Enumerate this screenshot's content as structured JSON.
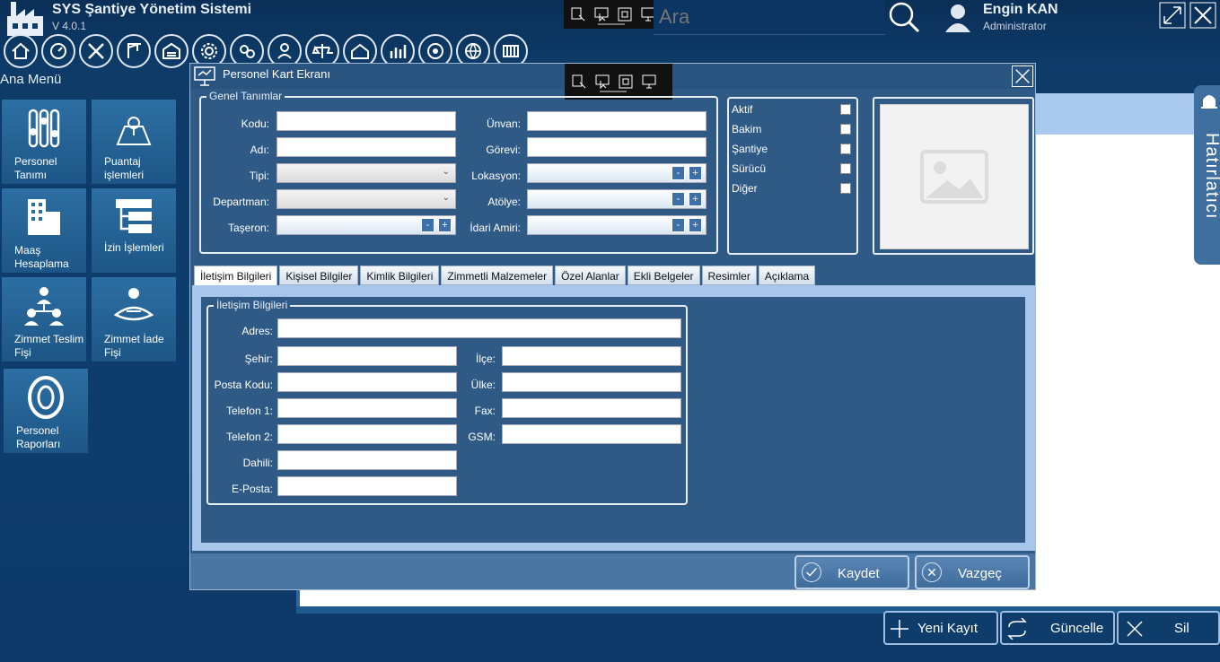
{
  "app": {
    "title": "SYS Şantiye Yönetim Sistemi",
    "version": "V 4.0.1"
  },
  "search": {
    "placeholder": "Ara"
  },
  "user": {
    "name": "Engin KAN",
    "role": "Administrator"
  },
  "menu": {
    "title": "Ana Menü",
    "tiles": [
      {
        "label": "Personel Tanımı",
        "icon": "sliders-icon"
      },
      {
        "label": "Puantaj işlemleri",
        "icon": "map-pin-icon"
      },
      {
        "label": "Maaş Hesaplama",
        "icon": "building-icon"
      },
      {
        "label": "İzin İşlemleri",
        "icon": "hierarchy-icon"
      },
      {
        "label": "Zimmet Teslim Fişi",
        "icon": "people-network-icon"
      },
      {
        "label": "Zimmet İade Fişi",
        "icon": "hand-return-icon"
      },
      {
        "label": "Personel Raporları",
        "icon": "tire-icon"
      }
    ]
  },
  "toolbar_icons": [
    "home-icon",
    "dashboard-icon",
    "tools-icon",
    "crane-icon",
    "warehouse-icon",
    "gear-settings-icon",
    "settings-group-icon",
    "worker-icon",
    "scale-icon",
    "house-icon",
    "chart-building-icon",
    "globe-network-icon",
    "globe-icon",
    "barrier-icon"
  ],
  "modal": {
    "title": "Personel Kart Ekranı",
    "general": {
      "title": "Genel Tanımlar",
      "fields_left": [
        {
          "label": "Kodu:",
          "type": "text",
          "value": ""
        },
        {
          "label": "Adı:",
          "type": "text",
          "value": ""
        },
        {
          "label": "Tipi:",
          "type": "combo",
          "value": ""
        },
        {
          "label": "Departman:",
          "type": "combo",
          "value": ""
        },
        {
          "label": "Taşeron:",
          "type": "spin",
          "value": ""
        }
      ],
      "fields_right": [
        {
          "label": "Ünvan:",
          "type": "text",
          "value": ""
        },
        {
          "label": "Görevi:",
          "type": "text",
          "value": ""
        },
        {
          "label": "Lokasyon:",
          "type": "spin",
          "value": ""
        },
        {
          "label": "Atölye:",
          "type": "spin",
          "value": ""
        },
        {
          "label": "İdari Amiri:",
          "type": "spin",
          "value": ""
        }
      ]
    },
    "flags": [
      {
        "label": "Aktif",
        "checked": false
      },
      {
        "label": "Bakim",
        "checked": false
      },
      {
        "label": "Şantiye",
        "checked": false
      },
      {
        "label": "Sürücü",
        "checked": false
      },
      {
        "label": "Diğer",
        "checked": false
      }
    ],
    "tabs": [
      "İletişim Bilgileri",
      "Kişisel Bilgiler",
      "Kimlik Bilgileri",
      "Zimmetli Malzemeler",
      "Özel Alanlar",
      "Ekli Belgeler",
      "Resimler",
      "Açıklama"
    ],
    "active_tab": "İletişim Bilgileri",
    "contact": {
      "title": "İletişim Bilgileri",
      "address_label": "Adres:",
      "left": [
        {
          "label": "Şehir:",
          "value": ""
        },
        {
          "label": "Posta Kodu:",
          "value": ""
        },
        {
          "label": "Telefon 1:",
          "value": ""
        },
        {
          "label": "Telefon 2:",
          "value": ""
        },
        {
          "label": "Dahili:",
          "value": ""
        },
        {
          "label": "E-Posta:",
          "value": ""
        }
      ],
      "right": [
        {
          "label": "İlçe:",
          "value": ""
        },
        {
          "label": "Ülke:",
          "value": ""
        },
        {
          "label": "Fax:",
          "value": ""
        },
        {
          "label": "GSM:",
          "value": ""
        }
      ]
    },
    "buttons": {
      "save": "Kaydet",
      "cancel": "Vazgeç"
    }
  },
  "background_actions": {
    "new": "Yeni Kayıt",
    "update": "Güncelle",
    "delete": "Sil"
  },
  "notifications": {
    "label": "Hatırlatıcı"
  },
  "spin_minus": "-",
  "spin_plus": "+",
  "colors": {
    "accent": "#2f5a85",
    "header": "#0e3c6a",
    "tile": "#2d6fa3"
  }
}
